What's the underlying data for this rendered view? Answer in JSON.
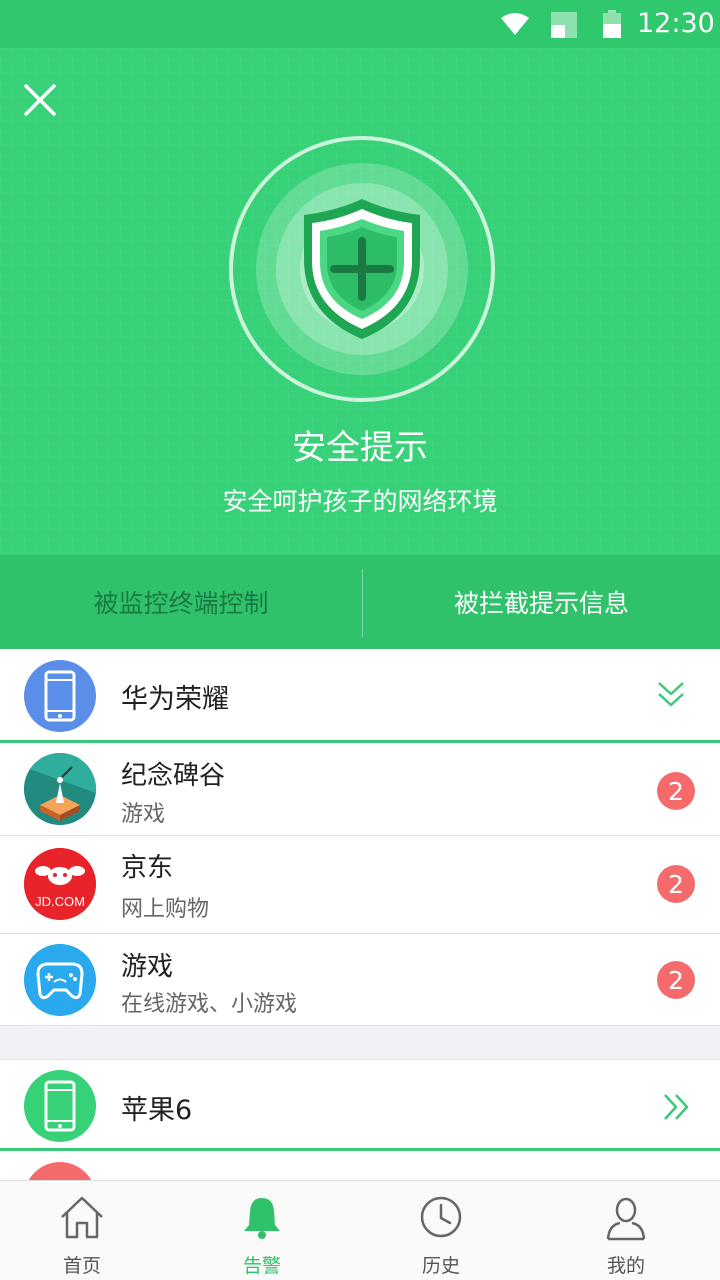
{
  "status_bar": {
    "time": "12:30"
  },
  "header": {
    "title": "安全提示",
    "subtitle": "安全呵护孩子的网络环境"
  },
  "tabs": [
    {
      "label": "被监控终端控制",
      "active": false
    },
    {
      "label": "被拦截提示信息",
      "active": true
    }
  ],
  "devices": [
    {
      "name": "华为荣耀",
      "avatar_color": "#5b8ee8",
      "expanded": true,
      "apps": [
        {
          "title": "纪念碑谷",
          "subtitle": "游戏",
          "count": "2",
          "icon": "monument-valley-icon"
        },
        {
          "title": "京东",
          "subtitle": "网上购物",
          "count": "2",
          "icon": "jd-icon",
          "icon_text": "JD.COM"
        },
        {
          "title": "游戏",
          "subtitle": "在线游戏、小游戏",
          "count": "2",
          "icon": "gamepad-icon"
        }
      ]
    },
    {
      "name": "苹果6",
      "avatar_color": "#37d278",
      "expanded": false
    }
  ],
  "bottom_nav": [
    {
      "label": "首页",
      "icon": "home-icon",
      "active": false
    },
    {
      "label": "告警",
      "icon": "bell-icon",
      "active": true
    },
    {
      "label": "历史",
      "icon": "clock-icon",
      "active": false
    },
    {
      "label": "我的",
      "icon": "user-icon",
      "active": false
    }
  ],
  "colors": {
    "primary": "#37d278",
    "badge": "#f56b6b"
  }
}
